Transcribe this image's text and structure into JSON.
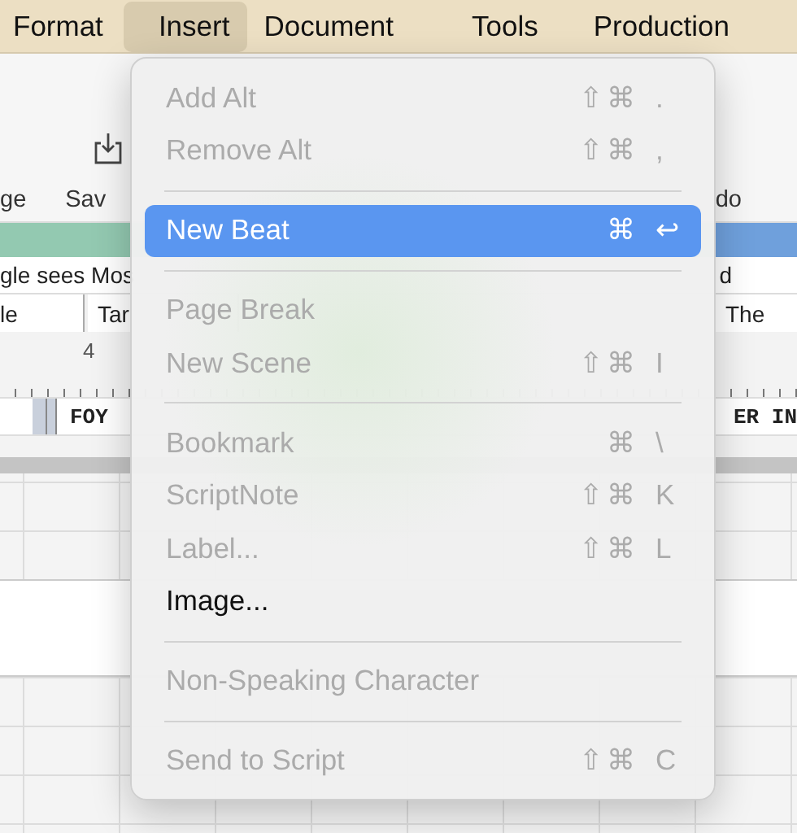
{
  "menu_bar": {
    "items": [
      {
        "label": "Format",
        "selected": false
      },
      {
        "label": "Insert",
        "selected": true
      },
      {
        "label": "Document",
        "selected": false
      },
      {
        "label": "Tools",
        "selected": false
      },
      {
        "label": "Production",
        "selected": false
      }
    ]
  },
  "toolbar": {
    "left_labels": [
      "ge",
      "Sav"
    ],
    "right_label": "do"
  },
  "script_strip": {
    "left_text": "gle sees Mos",
    "right_text": "d"
  },
  "fields": {
    "left": [
      "le",
      "Tar"
    ],
    "right": "The"
  },
  "ruler": {
    "label": "4"
  },
  "scene_strip": {
    "left": "FOY",
    "right": "ER IN"
  },
  "menu": {
    "items": [
      {
        "kind": "item",
        "label": "Add Alt",
        "modifiers": "⇧⌘",
        "key": ".",
        "disabled": true,
        "selected": false
      },
      {
        "kind": "item",
        "label": "Remove Alt",
        "modifiers": "⇧⌘",
        "key": ",",
        "disabled": true,
        "selected": false
      },
      {
        "kind": "separator"
      },
      {
        "kind": "item",
        "label": "New Beat",
        "modifiers": "⌘",
        "key": "↩",
        "disabled": false,
        "selected": true
      },
      {
        "kind": "separator"
      },
      {
        "kind": "item",
        "label": "Page Break",
        "disabled": true,
        "selected": false
      },
      {
        "kind": "item",
        "label": "New Scene",
        "modifiers": "⇧⌘",
        "key": "I",
        "disabled": true,
        "selected": false
      },
      {
        "kind": "separator"
      },
      {
        "kind": "item",
        "label": "Bookmark",
        "modifiers": "⌘",
        "key": "\\",
        "disabled": true,
        "selected": false
      },
      {
        "kind": "item",
        "label": "ScriptNote",
        "modifiers": "⇧⌘",
        "key": "K",
        "disabled": true,
        "selected": false
      },
      {
        "kind": "item",
        "label": "Label...",
        "modifiers": "⇧⌘",
        "key": "L",
        "disabled": true,
        "selected": false
      },
      {
        "kind": "item",
        "label": "Image...",
        "disabled": false,
        "selected": false
      },
      {
        "kind": "separator"
      },
      {
        "kind": "item",
        "label": "Non-Speaking Character",
        "disabled": true,
        "selected": false
      },
      {
        "kind": "separator"
      },
      {
        "kind": "item",
        "label": "Send to Script",
        "modifiers": "⇧⌘",
        "key": "C",
        "disabled": true,
        "selected": false
      }
    ]
  }
}
